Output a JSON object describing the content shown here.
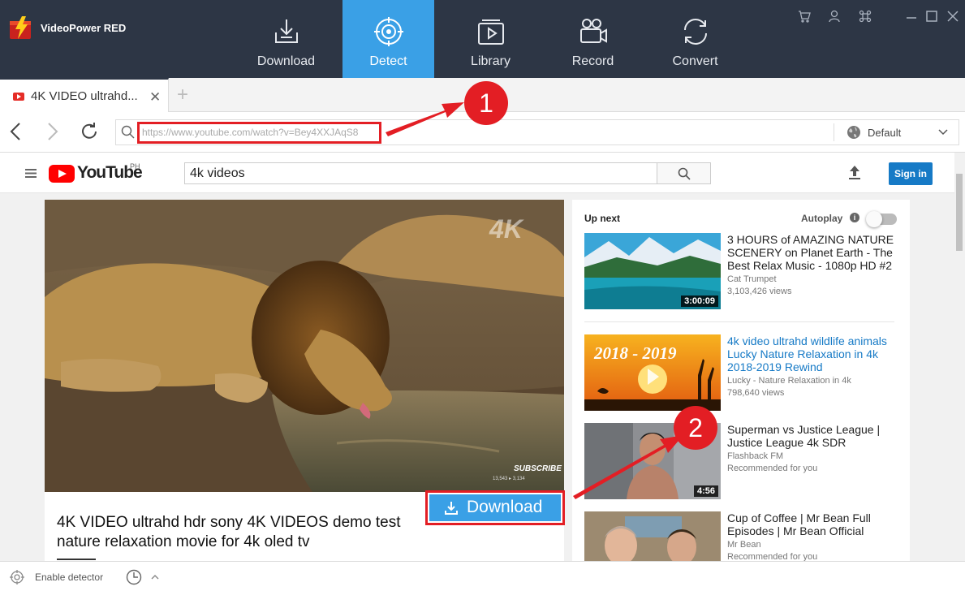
{
  "app": {
    "title": "VideoPower RED",
    "nav": [
      {
        "label": "Download",
        "icon": "download-icon"
      },
      {
        "label": "Detect",
        "icon": "detect-icon",
        "active": true
      },
      {
        "label": "Library",
        "icon": "library-icon"
      },
      {
        "label": "Record",
        "icon": "record-icon"
      },
      {
        "label": "Convert",
        "icon": "convert-icon"
      }
    ],
    "window_controls": [
      "cart-icon",
      "user-icon",
      "command-icon",
      "minimize-icon",
      "maximize-icon",
      "close-icon"
    ]
  },
  "browser": {
    "tab_title": "4K VIDEO ultrahd...",
    "url": "https://www.youtube.com/watch?v=Bey4XXJAqS8",
    "resolution_label": "Default"
  },
  "youtube": {
    "logo_text": "YouTube",
    "country": "PH",
    "search_value": "4k videos",
    "signin_label": "Sign in",
    "video": {
      "watermark": "4K",
      "subscribe_watermark": "SUBSCRIBE",
      "stats_watermark": "13,543 ▸ 3,134",
      "title": "4K VIDEO ultrahd hdr sony 4K VIDEOS demo test nature relaxation movie for 4k oled tv"
    },
    "download_button": "Download",
    "sidebar": {
      "up_next": "Up next",
      "autoplay": "Autoplay",
      "autoplay_on": false,
      "recommendations": [
        {
          "title": "3 HOURS of AMAZING NATURE SCENERY on Planet Earth - The Best Relax Music - 1080p HD #2",
          "channel": "Cat Trumpet",
          "meta": "3,103,426 views",
          "duration": "3:00:09"
        },
        {
          "title": "4k video ultrahd wildlife animals Lucky Nature Relaxation in 4k 2018-2019 Rewind",
          "channel": "Lucky - Nature Relaxation in 4k",
          "meta": "798,640 views",
          "thumb_text": "2018 - 2019"
        },
        {
          "title": "Superman vs Justice League | Justice League 4k SDR",
          "channel": "Flashback FM",
          "meta": "Recommended for you",
          "duration": "4:56"
        },
        {
          "title": "Cup of Coffee | Mr Bean Full Episodes | Mr Bean Official",
          "channel": "Mr Bean",
          "meta": "Recommended for you"
        }
      ]
    }
  },
  "callouts": [
    "1",
    "2"
  ],
  "status": {
    "detector_label": "Enable detector"
  },
  "colors": {
    "topbar": "#2d3645",
    "accent": "#3aa0e6",
    "callout": "#e31e24",
    "yt_red": "#ff0000",
    "link_blue": "#167ac6"
  }
}
